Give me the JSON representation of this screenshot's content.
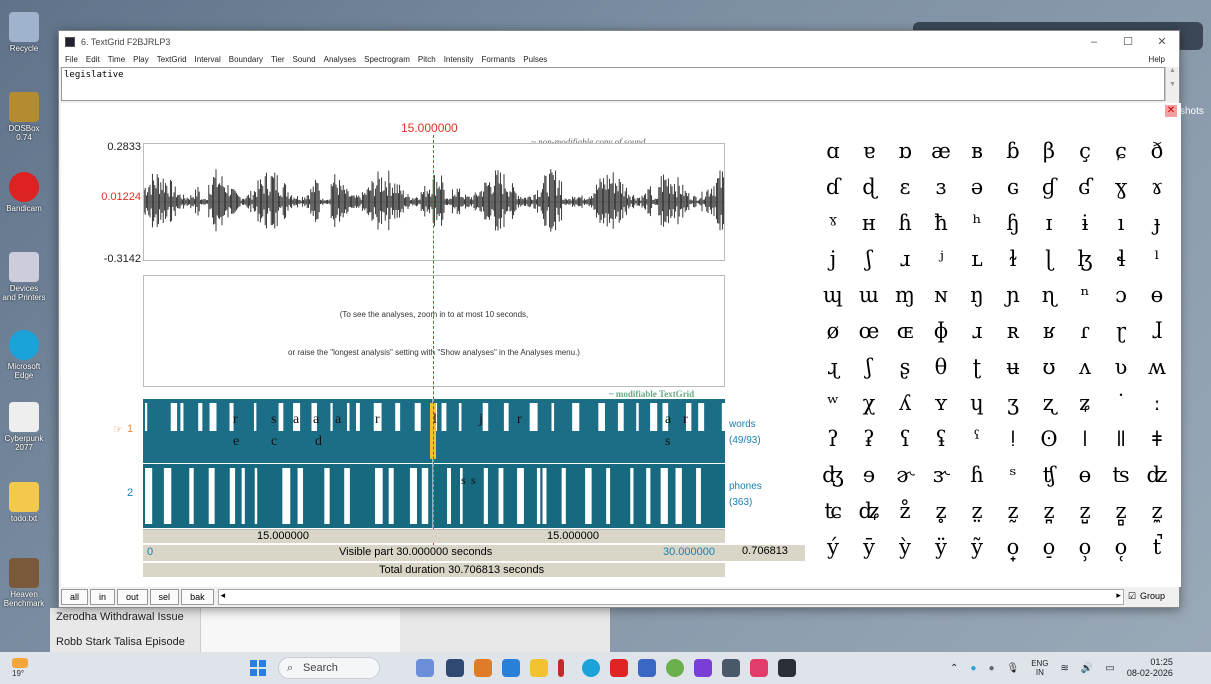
{
  "desktop": {
    "icons": [
      "Recycle",
      "DOSBox 0.74",
      "Bandicam",
      "Devices and Printers",
      "Microsoft Edge",
      "Cyberpunk 2077",
      "todo.txt",
      "Heaven Benchmark"
    ],
    "right_label": "shots",
    "background_items": [
      "Zerodha Withdrawal Issue",
      "Robb Stark Talisa Episode"
    ]
  },
  "window": {
    "title": "6. TextGrid F2BJRLP3",
    "controls": [
      "–",
      "☐",
      "✕"
    ],
    "menu": [
      "File",
      "Edit",
      "Time",
      "Play",
      "TextGrid",
      "Interval",
      "Boundary",
      "Tier",
      "Sound",
      "Analyses",
      "Spectrogram",
      "Pitch",
      "Intensity",
      "Formants",
      "Pulses"
    ],
    "help": "Help",
    "text_field": "legislative"
  },
  "editor": {
    "cursor_time": "15.000000",
    "wave_max": "0.2833",
    "wave_mid": "0.01224",
    "wave_min": "-0.3142",
    "sound_caption": "~ non-modifiable copy of sound",
    "analysis_msg_1": "(To see the analyses, zoom in to at most 10 seconds,",
    "analysis_msg_2": "or raise the \"longest analysis\" setting with \"Show analyses\" in the Analyses menu.)",
    "textgrid_caption": "~ modifiable TextGrid",
    "tier1_num": "1",
    "tier1_arrow": "☞",
    "tier2_num": "2",
    "tier1_name": "words",
    "tier1_count": "(49/93)",
    "tier2_name": "phones",
    "tier2_count": "(363)",
    "tier1_letters_top": [
      "r",
      "s",
      "a",
      "a",
      "a",
      "r",
      "l",
      "j",
      "r",
      "a",
      "r"
    ],
    "tier1_letters_bottom": [
      "e",
      "c",
      "d",
      "s"
    ],
    "tier2_letters": [
      "s",
      "s"
    ],
    "left_time": "15.000000",
    "right_time": "15.000000",
    "visible_start": "0",
    "visible_label": "Visible part 30.000000 seconds",
    "visible_end": "30.000000",
    "total_end": "0.706813",
    "total_label": "Total duration 30.706813 seconds"
  },
  "bottom": {
    "buttons": [
      "all",
      "in",
      "out",
      "sel",
      "bak"
    ],
    "scroll_left": "◂",
    "scroll_right": "▸",
    "group_check": "☑",
    "group_label": "Group"
  },
  "ipa": {
    "close": "✕",
    "symbols": [
      "ɑ",
      "ɐ",
      "ɒ",
      "æ",
      "ʙ",
      "ɓ",
      "β",
      "ç",
      "ɕ",
      "ð",
      "ɗ",
      "ɖ",
      "ɛ",
      "ɜ",
      "ə",
      "ɢ",
      "ɠ",
      "ʛ",
      "ɣ",
      "ɤ",
      "ˠ",
      "ʜ",
      "ɦ",
      "ħ",
      "ʰ",
      "ɧ",
      "ɪ",
      "ɨ",
      "ı",
      "ɟ",
      "j",
      "ʃ",
      "ɹ",
      "ʲ",
      "ʟ",
      "ɫ",
      "ɭ",
      "ɮ",
      "ɬ",
      "ˡ",
      "ɰ",
      "ɯ",
      "ɱ",
      "ɴ",
      "ŋ",
      "ɲ",
      "ɳ",
      "ⁿ",
      "ɔ",
      "ɵ",
      "ø",
      "œ",
      "ɶ",
      "ɸ",
      "ɹ",
      "ʀ",
      "ʁ",
      "ɾ",
      "ɽ",
      "ɺ",
      "ɻ",
      "ʃ",
      "ʂ",
      "θ",
      "ʈ",
      "ʉ",
      "ʊ",
      "ʌ",
      "ʋ",
      "ʍ",
      "ʷ",
      "χ",
      "ʎ",
      "ʏ",
      "ɥ",
      "ʒ",
      "ʐ",
      "ʑ",
      "˙",
      "ː",
      "ʔ",
      "ʡ",
      "ʕ",
      "ʢ",
      "ˤ",
      "ǃ",
      "ʘ",
      "ǀ",
      "ǁ",
      "ǂ",
      "ʤ",
      "ɘ",
      "ɚ",
      "ɝ",
      "ɦ",
      "ˢ",
      "ʧ",
      "ɵ",
      "ʦ",
      "ʣ",
      "ʨ",
      "ʥ",
      "z̊",
      "z̥",
      "z̤",
      "z̰",
      "z̪",
      "z̺",
      "z̻",
      "z̼",
      "ý",
      "ȳ",
      "ỳ",
      "ÿ",
      "ỹ",
      "o̟",
      "o̠",
      "o̹",
      "o̜",
      "t̚"
    ]
  },
  "taskbar": {
    "weather": "19°",
    "search": "Search",
    "lang_1": "ENG",
    "lang_2": "IN",
    "time": "01:25",
    "date": "08-02-2026",
    "colors": {
      "start": "#2a7de1",
      "accent": "#1b6e86",
      "cursor": "#dd3322"
    }
  }
}
